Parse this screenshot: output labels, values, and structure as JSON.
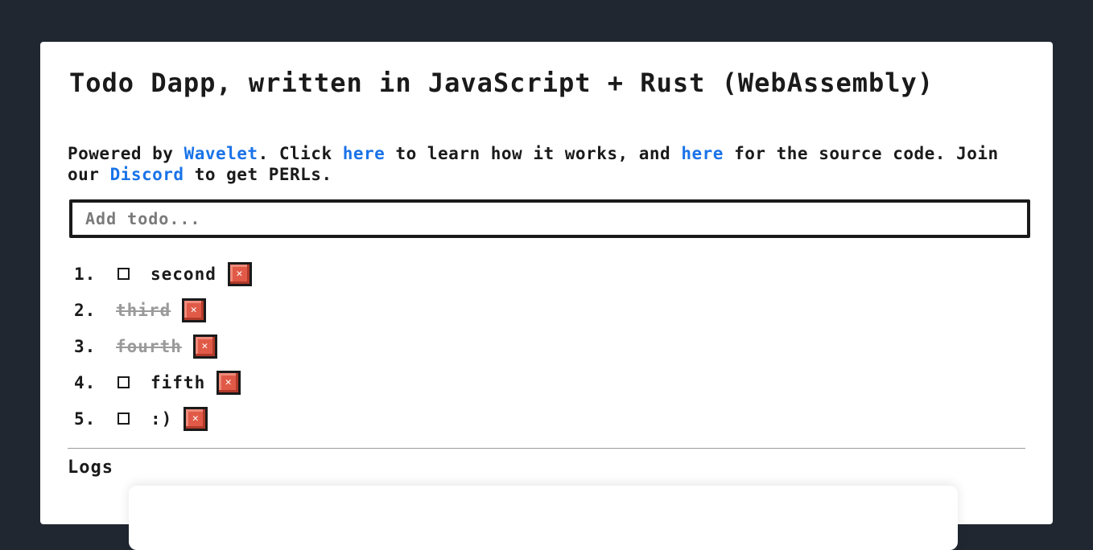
{
  "app": {
    "title": "Todo Dapp, written in JavaScript + Rust (WebAssembly)"
  },
  "intro": {
    "text_1": "Powered by ",
    "link_wavelet": "Wavelet",
    "text_2": ". Click ",
    "link_here_1": "here",
    "text_3": " to learn how it works, and ",
    "link_here_2": "here",
    "text_4": " for the source code. Join our ",
    "link_discord": "Discord",
    "text_5": " to get PERLs."
  },
  "add_todo": {
    "placeholder": "Add todo..."
  },
  "todos": [
    {
      "number": "1.",
      "text": "second",
      "done": false
    },
    {
      "number": "2.",
      "text": "third",
      "done": true
    },
    {
      "number": "3.",
      "text": "fourth",
      "done": true
    },
    {
      "number": "4.",
      "text": "fifth",
      "done": false
    },
    {
      "number": "5.",
      "text": ":)",
      "done": false
    }
  ],
  "delete_glyph": "✕",
  "logs": {
    "title": "Logs"
  },
  "colors": {
    "background": "#212731",
    "link": "#1a73e8",
    "delete_button": "#e05a47"
  }
}
